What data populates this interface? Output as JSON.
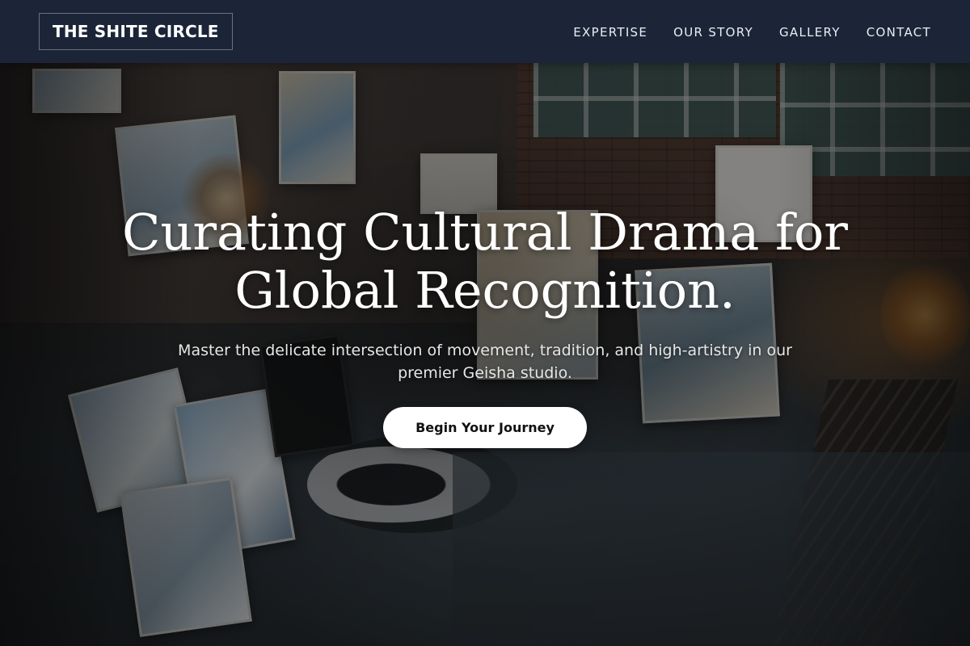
{
  "navbar": {
    "brand": "THE SHITE CIRCLE",
    "links": [
      "EXPERTISE",
      "OUR STORY",
      "GALLERY",
      "CONTACT"
    ],
    "background": "#1c2537"
  },
  "hero": {
    "title_line1": "Curating Cultural Drama for",
    "title_line2": "Global Recognition.",
    "subtitle_line1": "Master the delicate intersection of movement, tradition, and high-artistry in our",
    "subtitle_line2": "premier Geisha studio.",
    "cta_label": "Begin Your Journey",
    "background_image": "art-studio-photo"
  },
  "colors": {
    "nav_text": "#e9edf5",
    "hero_text": "#ffffff",
    "cta_background": "#ffffff",
    "cta_text": "#111111"
  }
}
